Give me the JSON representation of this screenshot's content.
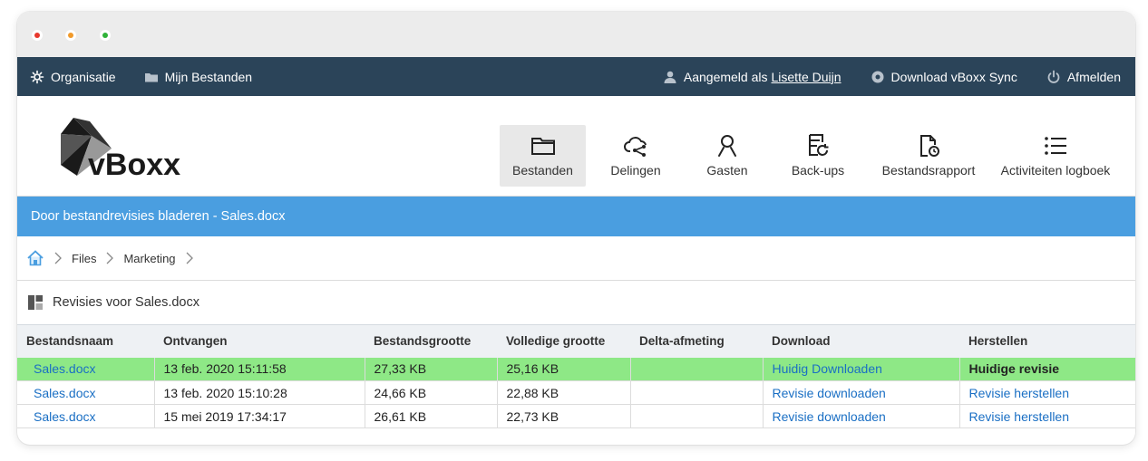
{
  "topnav": {
    "organisatie": "Organisatie",
    "mijn_bestanden": "Mijn Bestanden",
    "aangemeld_prefix": "Aangemeld als",
    "user_name": "Lisette Duijn",
    "download_sync": "Download vBoxx Sync",
    "afmelden": "Afmelden"
  },
  "logo": {
    "text": "vBoxx"
  },
  "tabs": [
    {
      "label": "Bestanden",
      "icon": "folder-icon",
      "active": true
    },
    {
      "label": "Delingen",
      "icon": "cloud-share-icon",
      "active": false
    },
    {
      "label": "Gasten",
      "icon": "user-icon",
      "active": false
    },
    {
      "label": "Back-ups",
      "icon": "backup-icon",
      "active": false
    },
    {
      "label": "Bestandsrapport",
      "icon": "file-report-icon",
      "active": false
    },
    {
      "label": "Activiteiten logboek",
      "icon": "list-icon",
      "active": false
    }
  ],
  "bluebar": {
    "title": "Door bestandrevisies bladeren - Sales.docx"
  },
  "breadcrumb": {
    "items": [
      "Files",
      "Marketing"
    ]
  },
  "section": {
    "title": "Revisies voor Sales.docx"
  },
  "table": {
    "headers": [
      "Bestandsnaam",
      "Ontvangen",
      "Bestandsgrootte",
      "Volledige grootte",
      "Delta-afmeting",
      "Download",
      "Herstellen"
    ],
    "rows": [
      {
        "name": "Sales.docx",
        "received": "13 feb. 2020 15:11:58",
        "size": "27,33 KB",
        "full": "25,16 KB",
        "delta": "",
        "download": "Huidig Downloaden",
        "restore": "Huidige revisie"
      },
      {
        "name": "Sales.docx",
        "received": "13 feb. 2020 15:10:28",
        "size": "24,66 KB",
        "full": "22,88 KB",
        "delta": "",
        "download": "Revisie downloaden",
        "restore": "Revisie herstellen"
      },
      {
        "name": "Sales.docx",
        "received": "15 mei 2019 17:34:17",
        "size": "26,61 KB",
        "full": "22,73 KB",
        "delta": "",
        "download": "Revisie downloaden",
        "restore": "Revisie herstellen"
      }
    ]
  },
  "colors": {
    "topnav_bg": "#2b4459",
    "bluebar_bg": "#4a9ee0",
    "current_row": "#8ee886",
    "link": "#1a6fc4"
  }
}
